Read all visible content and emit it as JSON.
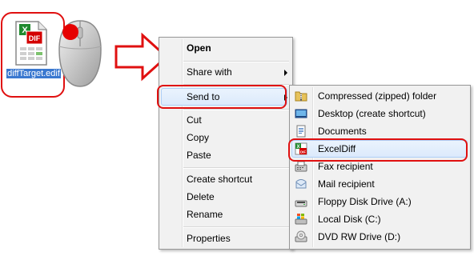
{
  "file": {
    "label": "diffTarget.edif",
    "badge": "DIF"
  },
  "context_menu": {
    "items": [
      {
        "label": "Open"
      },
      {
        "label": "Share with"
      },
      {
        "label": "Send to"
      },
      {
        "label": "Cut"
      },
      {
        "label": "Copy"
      },
      {
        "label": "Paste"
      },
      {
        "label": "Create shortcut"
      },
      {
        "label": "Delete"
      },
      {
        "label": "Rename"
      },
      {
        "label": "Properties"
      }
    ]
  },
  "send_to_menu": {
    "items": [
      {
        "label": "Compressed (zipped) folder",
        "icon": "zip-folder-icon"
      },
      {
        "label": "Desktop (create shortcut)",
        "icon": "desktop-icon"
      },
      {
        "label": "Documents",
        "icon": "documents-icon"
      },
      {
        "label": "ExcelDiff",
        "icon": "exceldiff-icon",
        "badge": "DIF"
      },
      {
        "label": "Fax recipient",
        "icon": "fax-icon"
      },
      {
        "label": "Mail recipient",
        "icon": "mail-icon"
      },
      {
        "label": "Floppy Disk Drive (A:)",
        "icon": "floppy-icon"
      },
      {
        "label": "Local Disk (C:)",
        "icon": "local-disk-icon"
      },
      {
        "label": "DVD RW Drive (D:)",
        "icon": "dvd-drive-icon"
      }
    ]
  },
  "colors": {
    "highlight_border": "#e01010",
    "menu_bg": "#f1f1f1",
    "selection": "#dceafc"
  }
}
